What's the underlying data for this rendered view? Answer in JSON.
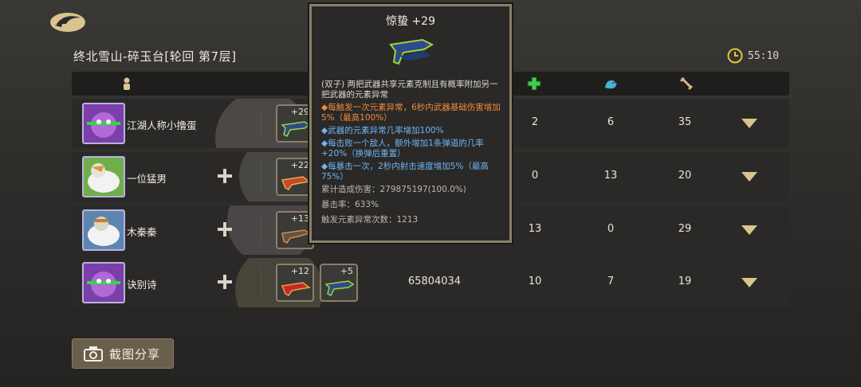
{
  "stage": {
    "title": "终北雪山-碎玉台[轮回 第7层]"
  },
  "timer": {
    "value": "55:10"
  },
  "rows": [
    {
      "name": "江湖人称小撸蛋",
      "weapons": [
        "+29"
      ],
      "damage": "",
      "stat1": "2",
      "stat2": "6",
      "stat3": "35"
    },
    {
      "name": "一位猛男",
      "weapons": [
        "+22"
      ],
      "damage": "",
      "stat1": "0",
      "stat2": "13",
      "stat3": "20"
    },
    {
      "name": "木秦秦",
      "weapons": [
        "+13"
      ],
      "damage": "",
      "stat1": "13",
      "stat2": "0",
      "stat3": "29"
    },
    {
      "name": "诀别诗",
      "weapons": [
        "+12",
        "+5"
      ],
      "damage": "65804034",
      "stat1": "10",
      "stat2": "7",
      "stat3": "19"
    }
  ],
  "tooltip": {
    "title": "惊蛰 +29",
    "line_0": "(双子) 两把武器共享元素克制且有概率附加另一把武器的元素异常",
    "line_1": "◆每触发一次元素异常，6秒内武器基础伤害增加5%（最高100%）",
    "line_2": "◆武器的元素异常几率增加100%",
    "line_3": "◆每击败一个敌人，额外增加1条弹道的几率+20%（换弹后重置）",
    "line_4": "◆每暴击一次，2秒内射击速度增加5%（最高75%）",
    "stat_damage": "累计造成伤害：279875197(100.0%)",
    "stat_crit": "暴击率：633%",
    "stat_trigger": "触发元素异常次数：1213"
  },
  "share": {
    "label": "截图分享"
  }
}
